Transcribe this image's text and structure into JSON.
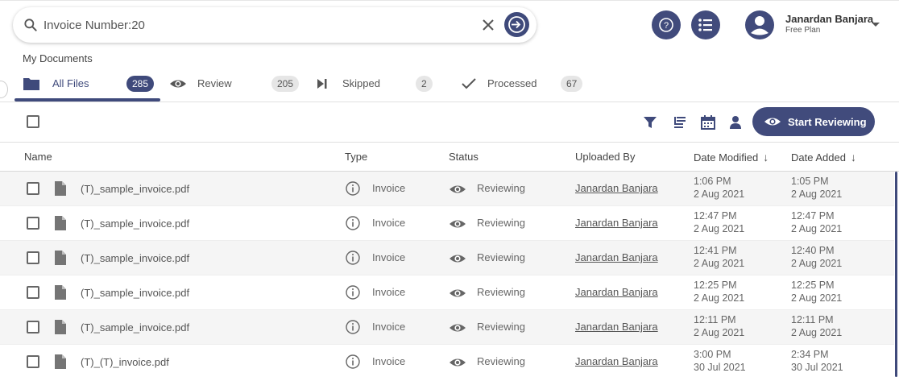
{
  "search": {
    "value": "Invoice Number:20",
    "placeholder": ""
  },
  "user": {
    "name": "Janardan Banjara",
    "plan": "Free Plan"
  },
  "section_title": "My Documents",
  "tabs": [
    {
      "label": "All Files",
      "count": "285",
      "icon": "folder-icon",
      "active": true
    },
    {
      "label": "Review",
      "count": "205",
      "icon": "eye-icon",
      "active": false
    },
    {
      "label": "Skipped",
      "count": "2",
      "icon": "skip-icon",
      "active": false
    },
    {
      "label": "Processed",
      "count": "67",
      "icon": "check-icon",
      "active": false
    }
  ],
  "toolbar": {
    "start_label": "Start Reviewing"
  },
  "columns": {
    "name": "Name",
    "type": "Type",
    "status": "Status",
    "uploaded_by": "Uploaded By",
    "date_modified": "Date Modified",
    "date_added": "Date Added"
  },
  "rows": [
    {
      "name": "(T)_sample_invoice.pdf",
      "type": "Invoice",
      "status": "Reviewing",
      "uploader": "Janardan Banjara",
      "mod_time": "1:06 PM",
      "mod_date": "2 Aug 2021",
      "add_time": "1:05 PM",
      "add_date": "2 Aug 2021"
    },
    {
      "name": "(T)_sample_invoice.pdf",
      "type": "Invoice",
      "status": "Reviewing",
      "uploader": "Janardan Banjara",
      "mod_time": "12:47 PM",
      "mod_date": "2 Aug 2021",
      "add_time": "12:47 PM",
      "add_date": "2 Aug 2021"
    },
    {
      "name": "(T)_sample_invoice.pdf",
      "type": "Invoice",
      "status": "Reviewing",
      "uploader": "Janardan Banjara",
      "mod_time": "12:41 PM",
      "mod_date": "2 Aug 2021",
      "add_time": "12:40 PM",
      "add_date": "2 Aug 2021"
    },
    {
      "name": "(T)_sample_invoice.pdf",
      "type": "Invoice",
      "status": "Reviewing",
      "uploader": "Janardan Banjara",
      "mod_time": "12:25 PM",
      "mod_date": "2 Aug 2021",
      "add_time": "12:25 PM",
      "add_date": "2 Aug 2021"
    },
    {
      "name": "(T)_sample_invoice.pdf",
      "type": "Invoice",
      "status": "Reviewing",
      "uploader": "Janardan Banjara",
      "mod_time": "12:11 PM",
      "mod_date": "2 Aug 2021",
      "add_time": "12:11 PM",
      "add_date": "2 Aug 2021"
    },
    {
      "name": "(T)_(T)_invoice.pdf",
      "type": "Invoice",
      "status": "Reviewing",
      "uploader": "Janardan Banjara",
      "mod_time": "3:00 PM",
      "mod_date": "30 Jul 2021",
      "add_time": "2:34 PM",
      "add_date": "30 Jul 2021"
    }
  ],
  "colors": {
    "accent": "#3f4a7b",
    "badge": "#e6e6e6",
    "row_alt": "#f5f5f5"
  }
}
